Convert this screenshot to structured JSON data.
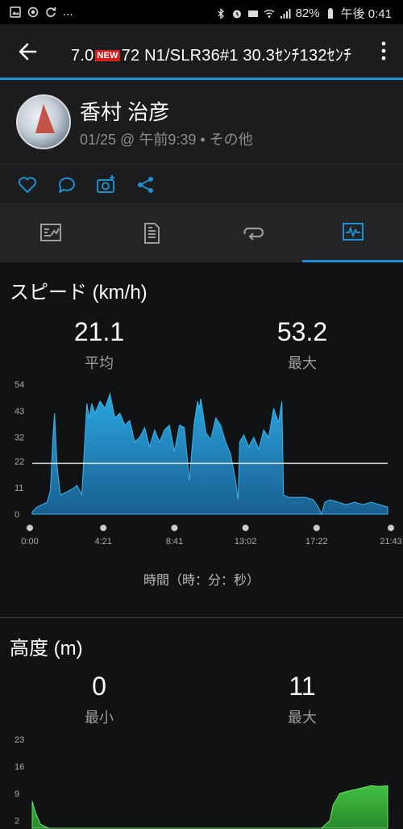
{
  "status_bar": {
    "left_icons": [
      "gallery-icon",
      "record-icon",
      "sync-icon"
    ],
    "left_more": "...",
    "battery": "82%",
    "time": "午後 0:41"
  },
  "top_bar": {
    "title_prefix": "7.0",
    "new_badge": "NEW",
    "title_suffix": "72 N1/SLR36#1 30.3ｾﾝﾁ132ｾﾝﾁ"
  },
  "profile": {
    "name": "香村 治彦",
    "meta": "01/25 @ 午前9:39 • その他"
  },
  "actions": [
    "like-icon",
    "comment-icon",
    "add-photo-icon",
    "share-icon"
  ],
  "tabs": [
    {
      "icon": "summary-icon",
      "selected": false
    },
    {
      "icon": "details-icon",
      "selected": false
    },
    {
      "icon": "laps-icon",
      "selected": false
    },
    {
      "icon": "charts-icon",
      "selected": true
    }
  ],
  "speed": {
    "title": "スピード (km/h)",
    "avg_value": "21.1",
    "avg_label": "平均",
    "max_value": "53.2",
    "max_label": "最大",
    "xaxis_title": "時間（時：分：秒）"
  },
  "elevation": {
    "title": "高度 (m)",
    "min_value": "0",
    "min_label": "最小",
    "max_value": "11",
    "max_label": "最大"
  },
  "colors": {
    "accent": "#1e8fd0",
    "speed_fill_top": "#2aa6e0",
    "speed_fill_bottom": "#1a5f90",
    "elev_fill": "#3fbf3f"
  },
  "chart_data": [
    {
      "type": "area",
      "x": [
        0,
        0.3,
        0.6,
        0.9,
        1.1,
        1.25,
        1.35,
        1.5,
        1.7,
        2.0,
        2.3,
        2.55,
        2.7,
        3.0,
        3.3,
        3.45,
        3.6,
        3.8,
        4.1,
        4.4,
        4.7,
        5.0,
        5.3,
        5.6,
        5.9,
        6.2,
        6.5,
        6.8,
        7.1,
        7.4,
        7.7,
        8.0,
        8.3,
        8.6,
        8.9,
        9.2,
        9.5,
        9.8,
        10.0,
        10.1,
        10.2,
        10.5,
        10.8,
        11.1,
        11.4,
        11.7,
        12.0,
        12.3,
        12.45,
        12.55,
        12.8,
        13.1,
        13.4,
        13.7,
        14.0,
        14.3,
        14.6,
        14.9,
        15.1,
        15.2,
        15.5,
        16.0,
        16.5,
        17.0,
        17.3,
        17.5,
        17.7,
        18.0,
        18.5,
        19.0,
        19.5,
        20.0,
        20.5,
        21.0,
        21.5
      ],
      "series": [
        {
          "values": [
            1,
            3,
            4,
            5,
            10,
            32,
            42,
            20,
            8,
            9,
            10,
            11,
            12,
            8,
            46,
            40,
            46,
            42,
            47,
            44,
            50,
            40,
            42,
            37,
            39,
            30,
            32,
            36,
            28,
            35,
            30,
            35,
            37,
            26,
            37,
            36,
            14,
            38,
            47,
            44,
            48,
            34,
            31,
            40,
            37,
            30,
            25,
            14,
            6,
            30,
            33,
            28,
            32,
            27,
            35,
            32,
            44,
            38,
            47,
            8,
            7,
            7,
            7,
            6,
            3,
            0,
            5,
            6,
            5,
            4,
            5,
            4,
            5,
            4,
            3
          ]
        }
      ],
      "xtick_labels": [
        "0:00",
        "4:21",
        "8:41",
        "13:02",
        "17:22",
        "21:43"
      ],
      "ytick_labels": [
        "0",
        "11",
        "22",
        "32",
        "43",
        "54"
      ],
      "ylim": [
        0,
        54
      ],
      "reference_line": 21.1,
      "xlabel": "時間（時：分：秒）",
      "ylabel": "スピード (km/h)"
    },
    {
      "type": "area",
      "x": [
        0,
        0.2,
        0.5,
        1,
        2,
        4,
        6,
        8,
        10,
        12,
        14,
        16,
        17.5,
        18,
        18.2,
        18.6,
        19,
        19.5,
        20,
        20.5,
        21,
        21.5
      ],
      "series": [
        {
          "values": [
            7,
            4,
            1,
            0,
            0,
            0,
            0,
            0,
            0,
            0,
            0,
            0,
            0,
            2,
            6,
            9,
            9.5,
            10,
            10.5,
            11,
            10.8,
            11
          ]
        }
      ],
      "ytick_labels": [
        "2",
        "9",
        "16",
        "23"
      ],
      "ylim": [
        0,
        23
      ],
      "ylabel": "高度 (m)"
    }
  ]
}
